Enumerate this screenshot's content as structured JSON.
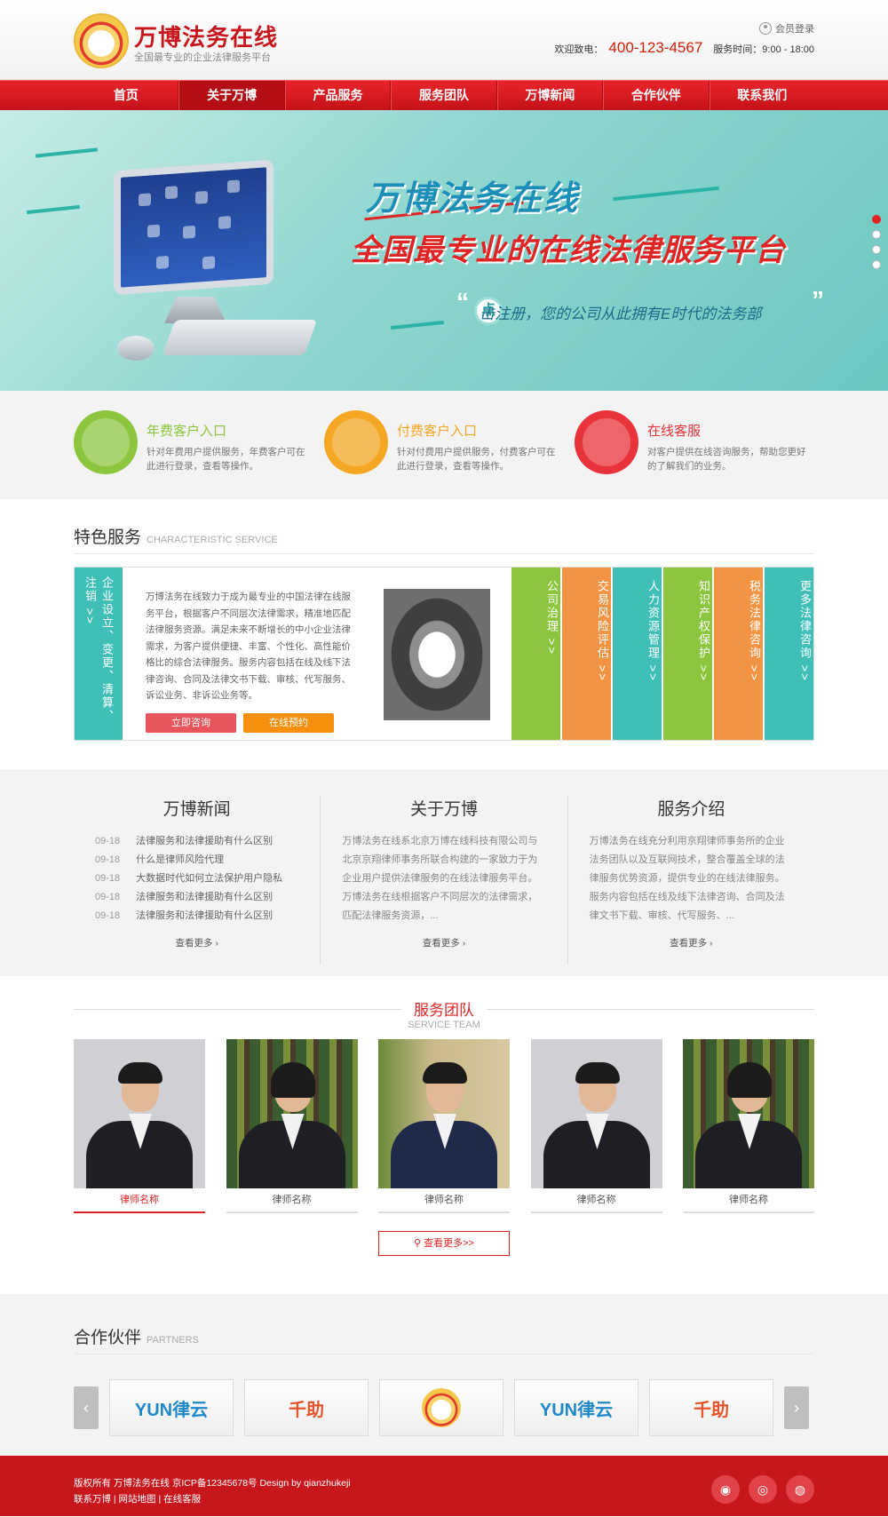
{
  "header": {
    "logo_title": "万博法务在线",
    "logo_subtitle": "全国最专业的企业法律服务平台",
    "member_login": "会员登录",
    "hotline_label": "欢迎致电：",
    "hotline_number": "400-123-4567",
    "service_hours": "服务时间：9:00 - 18:00"
  },
  "nav": {
    "items": [
      {
        "label": "首页"
      },
      {
        "label": "关于万博"
      },
      {
        "label": "产品服务"
      },
      {
        "label": "服务团队"
      },
      {
        "label": "万博新闻"
      },
      {
        "label": "合作伙伴"
      },
      {
        "label": "联系我们"
      }
    ],
    "active_index": 1
  },
  "banner": {
    "title": "万博法务在线",
    "slogan": "全国最专业的在线法律服务平台",
    "click_char": "点",
    "subline": "击注册，您的公司从此拥有E时代的法务部",
    "slide_count": 4,
    "active_slide": 0
  },
  "entries": [
    {
      "title": "年费客户入口",
      "desc": "针对年费用户提供服务，年费客户可在此进行登录，查看等操作。",
      "color": "#8cc63f",
      "icon": "user-icon"
    },
    {
      "title": "付费客户入口",
      "desc": "针对付费用户提供服务，付费客户可在此进行登录，查看等操作。",
      "color": "#f5a623",
      "icon": "user-icon"
    },
    {
      "title": "在线客服",
      "desc": "对客户提供在线咨询服务，帮助您更好的了解我们的业务。",
      "color": "#e8333a",
      "icon": "headset-icon"
    }
  ],
  "special": {
    "title": "特色服务",
    "title_en": "CHARACTERISTIC SERVICE",
    "side_tab": "企业设立、变更、清算、注销 >>",
    "body": "万博法务在线致力于成为最专业的中国法律在线服务平台，根据客户不同层次法律需求，精准地匹配法律服务资源。满足未来不断增长的中小企业法律需求，为客户提供便捷、丰富、个性化、高性能价格比的综合法律服务。服务内容包括在线及线下法律咨询、合同及法律文书下载、审核、代写服务、诉讼业务、非诉讼业务等。",
    "btn_consult": "立即咨询",
    "btn_book": "在线预约",
    "columns": [
      {
        "label": "公司治理",
        "color": "#8cc63f"
      },
      {
        "label": "交易风险评估",
        "color": "#f39444"
      },
      {
        "label": "人力资源管理",
        "color": "#3fbfb7"
      },
      {
        "label": "知识产权保护",
        "color": "#8cc63f"
      },
      {
        "label": "税务法律咨询",
        "color": "#f39444"
      },
      {
        "label": "更多法律咨询",
        "color": "#3fbfb7"
      }
    ]
  },
  "triple": {
    "news": {
      "title": "万博新闻",
      "items": [
        {
          "date": "09-18",
          "text": "法律服务和法律援助有什么区别"
        },
        {
          "date": "09-18",
          "text": "什么是律师风险代理"
        },
        {
          "date": "09-18",
          "text": "大数据时代如何立法保护用户隐私"
        },
        {
          "date": "09-18",
          "text": "法律服务和法律援助有什么区别"
        },
        {
          "date": "09-18",
          "text": "法律服务和法律援助有什么区别"
        }
      ],
      "more": "查看更多"
    },
    "about": {
      "title": "关于万博",
      "text": "万博法务在线系北京万博在线科技有限公司与北京京翔律师事务所联合构建的一家致力于为企业用户提供法律服务的在线法律服务平台。万博法务在线根据客户不同层次的法律需求，匹配法律服务资源，...",
      "more": "查看更多"
    },
    "service": {
      "title": "服务介绍",
      "text": "万博法务在线充分利用京翔律师事务所的企业法务团队以及互联网技术，整合覆盖全球的法律服务优势资源，提供专业的在线法律服务。服务内容包括在线及线下法律咨询、合同及法律文书下载、审核、代写服务、...",
      "more": "查看更多"
    }
  },
  "team": {
    "title": "服务团队",
    "title_en": "SERVICE TEAM",
    "members": [
      {
        "name": "律师名称"
      },
      {
        "name": "律师名称"
      },
      {
        "name": "律师名称"
      },
      {
        "name": "律师名称"
      },
      {
        "name": "律师名称"
      }
    ],
    "active_index": 0,
    "more": "查看更多>>"
  },
  "partners": {
    "title": "合作伙伴",
    "title_en": "PARTNERS",
    "logos": [
      {
        "name": "YUN律云",
        "color": "#1e88c8"
      },
      {
        "name": "千助",
        "color": "#e8542a"
      },
      {
        "name": "logo",
        "color": "#e8b93c"
      },
      {
        "name": "YUN律云",
        "color": "#1e88c8"
      },
      {
        "name": "千助",
        "color": "#e8542a"
      }
    ],
    "prev": "‹",
    "next": "›"
  },
  "footer": {
    "line1": "版权所有  万博法务在线  京ICP备12345678号  Design by qianzhukeji",
    "line2": "联系万博  |  网站地图  |  在线客服",
    "social": [
      "weibo-icon",
      "compass-icon",
      "wechat-icon"
    ]
  }
}
